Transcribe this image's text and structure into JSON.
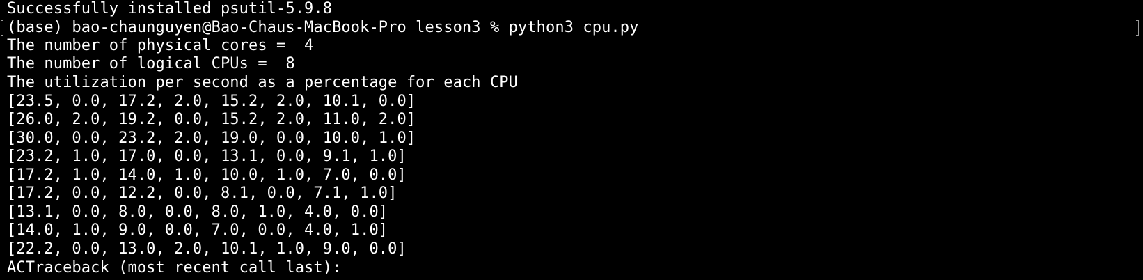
{
  "terminal": {
    "lines": [
      "Successfully installed psutil-5.9.8",
      "(base) bao-chaunguyen@Bao-Chaus-MacBook-Pro lesson3 % python3 cpu.py",
      "The number of physical cores =  4",
      "The number of logical CPUs =  8",
      "The utilization per second as a percentage for each CPU",
      "[23.5, 0.0, 17.2, 2.0, 15.2, 2.0, 10.1, 0.0]",
      "[26.0, 2.0, 19.2, 0.0, 15.2, 2.0, 11.0, 2.0]",
      "[30.0, 0.0, 23.2, 2.0, 19.0, 0.0, 10.0, 1.0]",
      "[23.2, 1.0, 17.0, 0.0, 13.1, 0.0, 9.1, 1.0]",
      "[17.2, 1.0, 14.0, 1.0, 10.0, 1.0, 7.0, 0.0]",
      "[17.2, 0.0, 12.2, 0.0, 8.1, 0.0, 7.1, 1.0]",
      "[13.1, 0.0, 8.0, 0.0, 8.0, 1.0, 4.0, 0.0]",
      "[14.0, 1.0, 9.0, 0.0, 7.0, 0.0, 4.0, 1.0]",
      "[22.2, 0.0, 13.0, 2.0, 10.1, 1.0, 9.0, 0.0]",
      "ACTraceback (most recent call last):"
    ]
  },
  "colors": {
    "background": "#000000",
    "text": "#ffffff",
    "mark_line": "#9a9a9a"
  }
}
